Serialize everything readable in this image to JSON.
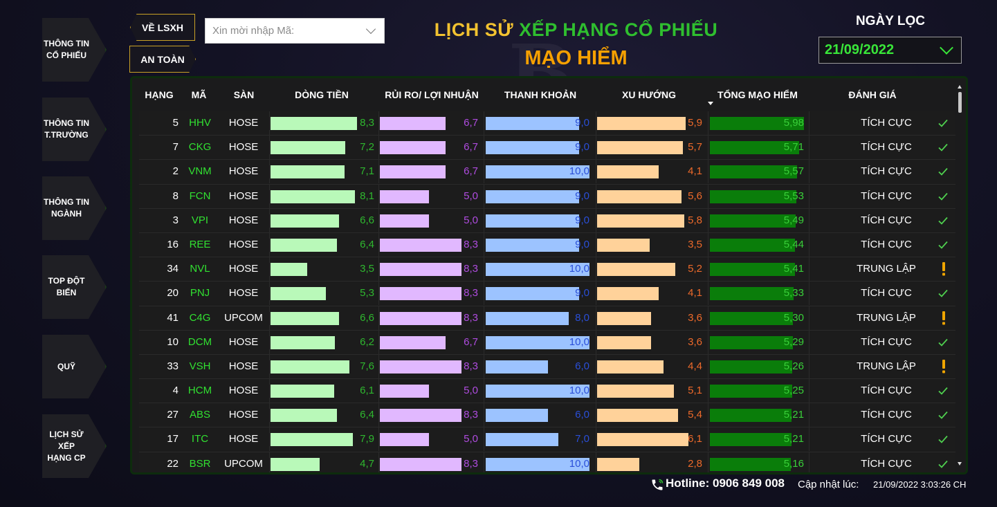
{
  "nav": [
    {
      "label1": "THÔNG TIN",
      "label2": "CỔ PHIẾU"
    },
    {
      "label1": "THÔNG TIN",
      "label2": "T.TRƯỜNG"
    },
    {
      "label1": "THÔNG TIN",
      "label2": "NGÀNH"
    },
    {
      "label1": "TOP ĐỘT",
      "label2": "BIẾN"
    },
    {
      "label1": "QUỸ",
      "label2": ""
    },
    {
      "label1": "LỊCH SỬ XẾP",
      "label2": "HẠNG CP"
    }
  ],
  "header": {
    "btn_back": "VỀ LSXH",
    "btn_safe": "AN TOÀN",
    "search_placeholder": "Xin mời nhập Mã:",
    "title_part1": "LỊCH SỬ ",
    "title_part2": "XẾP HẠNG CỔ PHIẾU",
    "title_line2": "MẠO HIỂM",
    "date_label": "NGÀY LỌC",
    "date_value": "21/09/2022"
  },
  "table": {
    "headers": [
      "HẠNG",
      "MÃ",
      "SÀN",
      "DÒNG TIỀN",
      "RỦI RO/ LỢI NHUẬN",
      "THANH KHOẢN",
      "XU HƯỚNG",
      "TỔNG MẠO HIỂM",
      "ĐÁNH GIÁ"
    ],
    "colors": {
      "dong_tien_bar": "#b9f9b9",
      "dong_tien_text": "#2fb82f",
      "rui_ro_bar": "#e1b8ff",
      "rui_ro_text": "#b04ce0",
      "thanh_khoan_bar": "#9cc3ff",
      "thanh_khoan_text": "#2a4fd8",
      "xu_huong_bar": "#ffd29a",
      "xu_huong_text": "#ee6a2a",
      "tong_bar": "#0a7d0a",
      "tong_text": "#39d039",
      "check": "#4fd14f",
      "warn": "#f0a500"
    },
    "rows": [
      {
        "hang": "5",
        "ma": "HHV",
        "san": "HOSE",
        "dong_tien": "8,3",
        "rui_ro": "6,7",
        "thanh_khoan": "9,0",
        "xu_huong": "5,9",
        "tong": "5,98",
        "danh_gia": "TÍCH CỰC",
        "icon": "check-icon"
      },
      {
        "hang": "7",
        "ma": "CKG",
        "san": "HOSE",
        "dong_tien": "7,2",
        "rui_ro": "6,7",
        "thanh_khoan": "9,0",
        "xu_huong": "5,7",
        "tong": "5,71",
        "danh_gia": "TÍCH CỰC",
        "icon": "check-icon"
      },
      {
        "hang": "2",
        "ma": "VNM",
        "san": "HOSE",
        "dong_tien": "7,1",
        "rui_ro": "6,7",
        "thanh_khoan": "10,0",
        "xu_huong": "4,1",
        "tong": "5,57",
        "danh_gia": "TÍCH CỰC",
        "icon": "check-icon"
      },
      {
        "hang": "8",
        "ma": "FCN",
        "san": "HOSE",
        "dong_tien": "8,1",
        "rui_ro": "5,0",
        "thanh_khoan": "9,0",
        "xu_huong": "5,6",
        "tong": "5,53",
        "danh_gia": "TÍCH CỰC",
        "icon": "check-icon"
      },
      {
        "hang": "3",
        "ma": "VPI",
        "san": "HOSE",
        "dong_tien": "6,6",
        "rui_ro": "5,0",
        "thanh_khoan": "9,0",
        "xu_huong": "5,8",
        "tong": "5,49",
        "danh_gia": "TÍCH CỰC",
        "icon": "check-icon"
      },
      {
        "hang": "16",
        "ma": "REE",
        "san": "HOSE",
        "dong_tien": "6,4",
        "rui_ro": "8,3",
        "thanh_khoan": "9,0",
        "xu_huong": "3,5",
        "tong": "5,44",
        "danh_gia": "TÍCH CỰC",
        "icon": "check-icon"
      },
      {
        "hang": "34",
        "ma": "NVL",
        "san": "HOSE",
        "dong_tien": "3,5",
        "rui_ro": "8,3",
        "thanh_khoan": "10,0",
        "xu_huong": "5,2",
        "tong": "5,41",
        "danh_gia": "TRUNG LẬP",
        "icon": "warning-icon"
      },
      {
        "hang": "20",
        "ma": "PNJ",
        "san": "HOSE",
        "dong_tien": "5,3",
        "rui_ro": "8,3",
        "thanh_khoan": "9,0",
        "xu_huong": "4,1",
        "tong": "5,33",
        "danh_gia": "TÍCH CỰC",
        "icon": "check-icon"
      },
      {
        "hang": "41",
        "ma": "C4G",
        "san": "UPCOM",
        "dong_tien": "6,6",
        "rui_ro": "8,3",
        "thanh_khoan": "8,0",
        "xu_huong": "3,6",
        "tong": "5,30",
        "danh_gia": "TRUNG LẬP",
        "icon": "warning-icon"
      },
      {
        "hang": "10",
        "ma": "DCM",
        "san": "HOSE",
        "dong_tien": "6,2",
        "rui_ro": "6,7",
        "thanh_khoan": "10,0",
        "xu_huong": "3,6",
        "tong": "5,29",
        "danh_gia": "TÍCH CỰC",
        "icon": "check-icon"
      },
      {
        "hang": "33",
        "ma": "VSH",
        "san": "HOSE",
        "dong_tien": "7,6",
        "rui_ro": "8,3",
        "thanh_khoan": "6,0",
        "xu_huong": "4,4",
        "tong": "5,26",
        "danh_gia": "TRUNG LẬP",
        "icon": "warning-icon"
      },
      {
        "hang": "4",
        "ma": "HCM",
        "san": "HOSE",
        "dong_tien": "6,1",
        "rui_ro": "5,0",
        "thanh_khoan": "10,0",
        "xu_huong": "5,1",
        "tong": "5,25",
        "danh_gia": "TÍCH CỰC",
        "icon": "check-icon"
      },
      {
        "hang": "27",
        "ma": "ABS",
        "san": "HOSE",
        "dong_tien": "6,4",
        "rui_ro": "8,3",
        "thanh_khoan": "6,0",
        "xu_huong": "5,4",
        "tong": "5,21",
        "danh_gia": "TÍCH CỰC",
        "icon": "check-icon"
      },
      {
        "hang": "17",
        "ma": "ITC",
        "san": "HOSE",
        "dong_tien": "7,9",
        "rui_ro": "5,0",
        "thanh_khoan": "7,0",
        "xu_huong": "6,1",
        "tong": "5,21",
        "danh_gia": "TÍCH CỰC",
        "icon": "check-icon"
      },
      {
        "hang": "22",
        "ma": "BSR",
        "san": "UPCOM",
        "dong_tien": "4,7",
        "rui_ro": "8,3",
        "thanh_khoan": "10,0",
        "xu_huong": "2,8",
        "tong": "5,16",
        "danh_gia": "TÍCH CỰC",
        "icon": "check-icon"
      }
    ]
  },
  "footer": {
    "hotline": "Hotline: 0906 849 008",
    "updated_label": "Cập nhật lúc:",
    "updated_time": "21/09/2022 3:03:26 CH"
  }
}
